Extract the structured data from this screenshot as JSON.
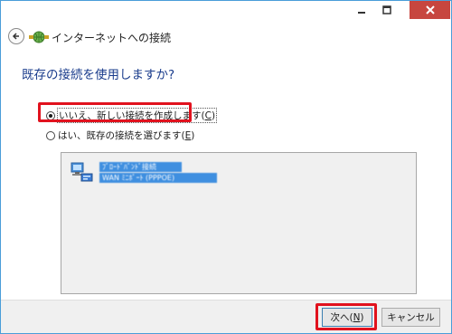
{
  "window": {
    "title": "インターネットへの接続",
    "controls": {
      "minimize_icon": "minimize-icon",
      "maximize_icon": "maximize-icon",
      "close_icon": "close-icon"
    },
    "back_icon": "back-arrow-icon",
    "app_icon": "network-connection-icon"
  },
  "main": {
    "heading": "既存の接続を使用しますか?",
    "options": [
      {
        "label_prefix": "いいえ、新しい接続を作成します(",
        "accel": "C",
        "label_suffix": ")",
        "selected": true
      },
      {
        "label_prefix": "はい、既存の接続を選びます(",
        "accel": "E",
        "label_suffix": ")",
        "selected": false
      }
    ],
    "connection_list": {
      "items": [
        {
          "icon": "network-adapter-icon",
          "line1": "ﾌﾞﾛｰﾄﾞﾊﾞﾝﾄﾞ接続",
          "line2": "WAN ﾐﾆﾎﾟｰﾄ (PPPOE)"
        }
      ]
    }
  },
  "footer": {
    "next": {
      "label_prefix": "次へ(",
      "accel": "N",
      "label_suffix": ")"
    },
    "cancel": "キャンセル"
  },
  "colors": {
    "heading": "#1a3c8c",
    "highlight": "#e1121e",
    "close_button": "#c7463f",
    "window_border": "#4a9dd9"
  }
}
